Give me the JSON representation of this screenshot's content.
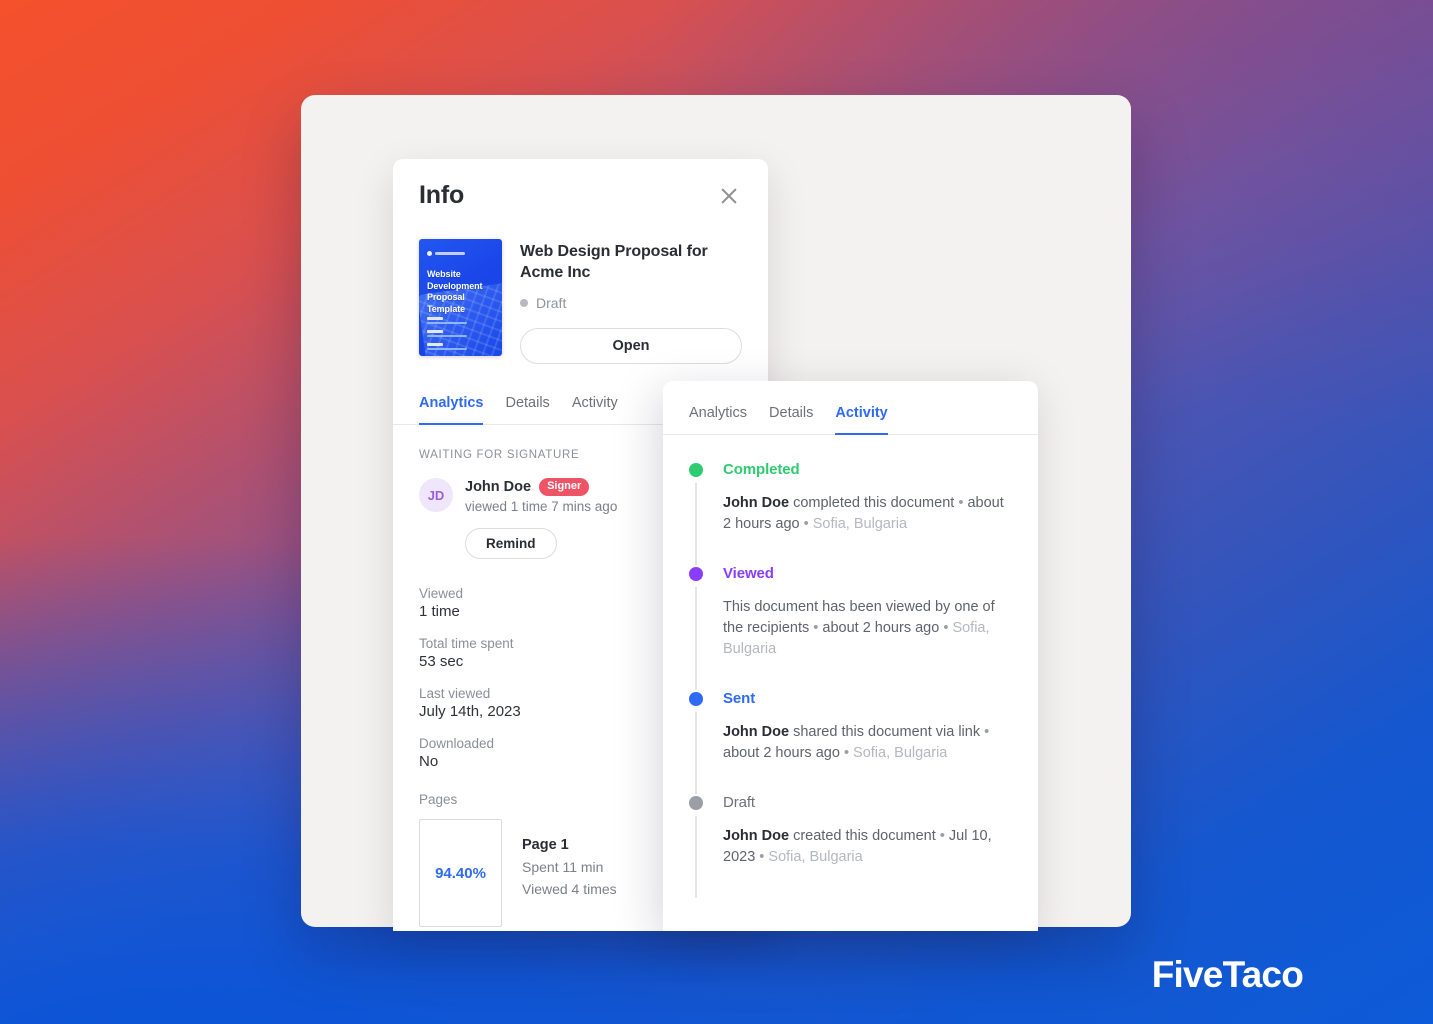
{
  "brand": {
    "logo_text": "FiveTaco"
  },
  "info_panel": {
    "title": "Info",
    "close_icon": "close-icon",
    "document": {
      "thumbnail_title": "Website Development Proposal Template",
      "name": "Web Design Proposal for Acme Inc",
      "status": "Draft",
      "status_color": "#b6b9bf",
      "open_label": "Open"
    },
    "tabs": [
      {
        "label": "Analytics",
        "active": true
      },
      {
        "label": "Details",
        "active": false
      },
      {
        "label": "Activity",
        "active": false
      }
    ],
    "section_label": "WAITING FOR SIGNATURE",
    "signer": {
      "initials": "JD",
      "name": "John Doe",
      "badge": "Signer",
      "badge_color": "#ef5466",
      "subtitle": "viewed 1 time 7 mins ago",
      "remind_label": "Remind"
    },
    "stats": [
      {
        "key": "Viewed",
        "value": "1 time"
      },
      {
        "key": "Total time spent",
        "value": "53 sec"
      },
      {
        "key": "Last viewed",
        "value": "July 14th, 2023"
      },
      {
        "key": "Downloaded",
        "value": "No"
      }
    ],
    "pages_label": "Pages",
    "pages": [
      {
        "percent": "94.40%",
        "title": "Page 1",
        "time_spent": "Spent 11 min",
        "views": "Viewed 4 times"
      }
    ]
  },
  "activity_panel": {
    "tabs": [
      {
        "label": "Analytics",
        "active": false
      },
      {
        "label": "Details",
        "active": false
      },
      {
        "label": "Activity",
        "active": true
      }
    ],
    "accent_color": "#2f6bf2",
    "events": [
      {
        "status": "Completed",
        "color": "#2ecc71",
        "actor": "John Doe",
        "action": "completed this document",
        "time": "about 2 hours ago",
        "location": "Sofia, Bulgaria"
      },
      {
        "status": "Viewed",
        "color": "#8b3dff",
        "actor": "",
        "action": "This document has been viewed by one of the recipients",
        "time": "about 2 hours ago",
        "location": "Sofia, Bulgaria"
      },
      {
        "status": "Sent",
        "color": "#2f6bf2",
        "actor": "John Doe",
        "action": "shared this document via link",
        "time": "about 2 hours ago",
        "location": "Sofia, Bulgaria"
      },
      {
        "status": "Draft",
        "color": "#9b9ea4",
        "actor": "John Doe",
        "action": "created this document",
        "time": "Jul 10, 2023",
        "location": "Sofia, Bulgaria"
      }
    ]
  }
}
